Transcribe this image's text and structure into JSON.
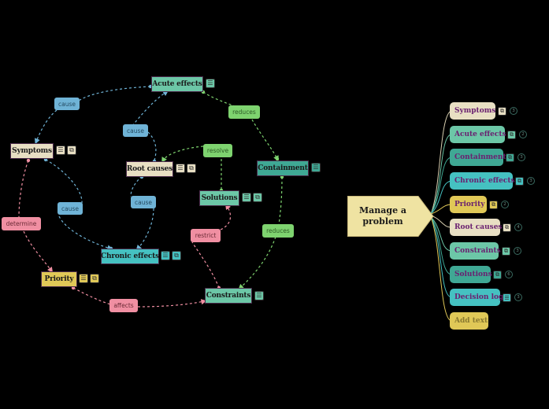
{
  "colors": {
    "background": "#000000",
    "cream": "#e8dfc3",
    "mint": "#6cc7a7",
    "teal": "#3fa894",
    "cyan": "#45c1c1",
    "yellow": "#e0c857",
    "link_blue": "#6fb3d6",
    "link_green": "#7ed36f",
    "link_pink": "#f08fa2"
  },
  "concept_map": {
    "nodes": {
      "acute_effects": "Acute effects",
      "symptoms": "Symptoms",
      "root_causes": "Root causes",
      "containment": "Containment",
      "solutions": "Solutions",
      "chronic_effects": "Chronic effects",
      "priority": "Priority",
      "constraints": "Constraints"
    },
    "link_labels": {
      "cause_1": "cause",
      "cause_2": "cause",
      "cause_3": "cause",
      "cause_4": "cause",
      "reduces_1": "reduces",
      "reduces_2": "reduces",
      "resolve": "resolve",
      "determine": "determine",
      "restrict": "restrict",
      "affects": "affects"
    },
    "icons": {
      "notes": "☰",
      "link": "⧉"
    }
  },
  "mind_map": {
    "root": "Manage a problem",
    "root_line1": "Manage a",
    "root_line2": "problem",
    "branches": [
      {
        "label": "Symptoms",
        "icon": "⧉",
        "count": "3"
      },
      {
        "label": "Acute effects",
        "icon": "⧉",
        "count": "2"
      },
      {
        "label": "Containment",
        "icon": "⧉",
        "count": "3"
      },
      {
        "label": "Chronic effects",
        "icon": "⧉",
        "count": "3"
      },
      {
        "label": "Priority",
        "icon": "⧉",
        "count": "2"
      },
      {
        "label": "Root causes",
        "icon": "⧉",
        "count": "4"
      },
      {
        "label": "Constraints",
        "icon": "⧉",
        "count": "3"
      },
      {
        "label": "Solutions",
        "icon": "⧉",
        "count": "6"
      },
      {
        "label": "Decision log",
        "icon": "☰",
        "count": "3"
      },
      {
        "label": "Add text"
      }
    ]
  }
}
